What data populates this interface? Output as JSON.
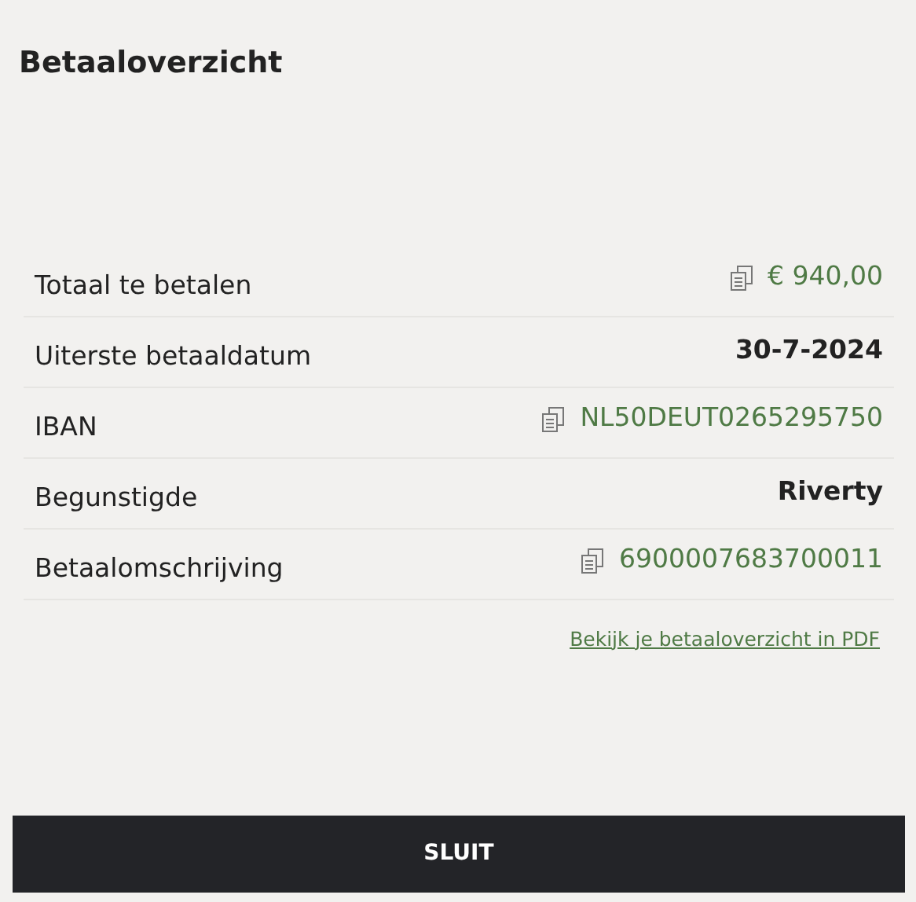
{
  "title": "Betaaloverzicht",
  "rows": [
    {
      "label": "Totaal te betalen",
      "value": "€ 940,00",
      "kind": "copy"
    },
    {
      "label": "Uiterste betaaldatum",
      "value": "30-7-2024",
      "kind": "plain"
    },
    {
      "label": "IBAN",
      "value": "NL50DEUT0265295750",
      "kind": "copy"
    },
    {
      "label": "Begunstigde",
      "value": "Riverty",
      "kind": "plain"
    },
    {
      "label": "Betaalomschrijving",
      "value": "6900007683700011",
      "kind": "copy"
    }
  ],
  "pdf_link": "Bekijk je betaaloverzicht in PDF",
  "button": "SLUIT"
}
